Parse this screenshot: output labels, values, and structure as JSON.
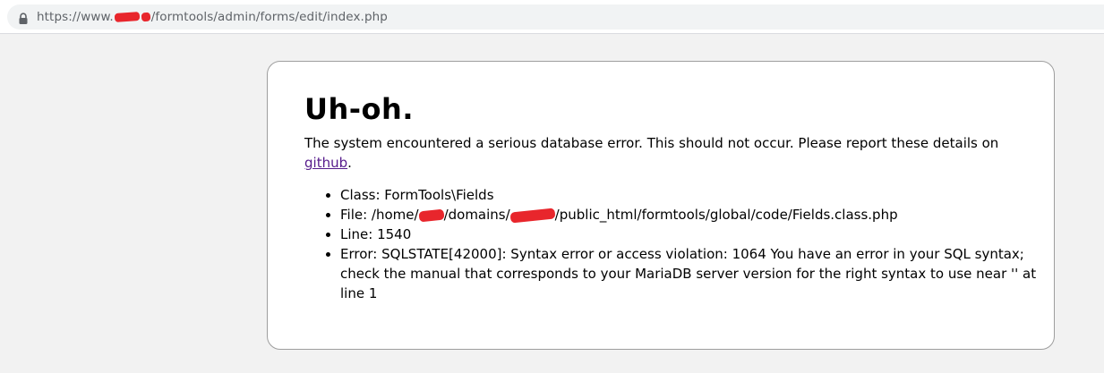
{
  "browser": {
    "url_scheme": "https://www.",
    "url_path": "/formtools/admin/forms/edit/index.php",
    "icon": "lock-icon"
  },
  "error": {
    "title": "Uh-oh.",
    "message_before_link": "The system encountered a serious database error. This should not occur. Please report these details on ",
    "link_text": "github",
    "message_after_link": ".",
    "details": {
      "class": "Class: FormTools\\Fields",
      "file_prefix": "File: /home/",
      "file_mid": "/domains/",
      "file_suffix": "/public_html/formtools/global/code/Fields.class.php",
      "line": "Line: 1540",
      "error": "Error: SQLSTATE[42000]: Syntax error or access violation: 1064 You have an error in your SQL syntax; check the manual that corresponds to your MariaDB server version for the right syntax to use near '' at line 1"
    }
  },
  "colors": {
    "redaction": "#e8262c",
    "link": "#551a8b",
    "page_background": "#f2f2f2"
  }
}
